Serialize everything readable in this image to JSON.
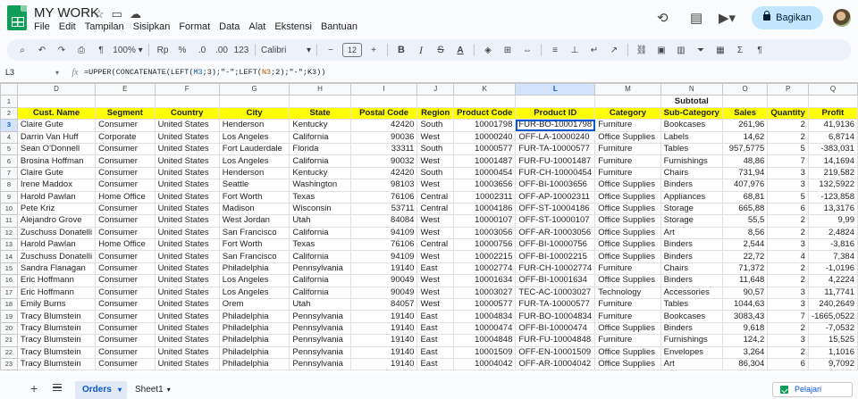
{
  "app": {
    "title": "MY WORK",
    "menu": [
      "File",
      "Edit",
      "Tampilan",
      "Sisipkan",
      "Format",
      "Data",
      "Alat",
      "Ekstensi",
      "Bantuan"
    ],
    "share_label": "Bagikan"
  },
  "toolbar": {
    "zoom": "100%",
    "currency": "Rp",
    "percent": "%",
    "dec_decrease": ".0",
    "dec_increase": ".00",
    "number_format": "123",
    "font": "Calibri",
    "font_size": "12"
  },
  "formula_bar": {
    "cell_ref": "L3",
    "formula_start": "=UPPER(CONCATENATE(LEFT(",
    "ref1": "M3",
    "formula_mid": ";3);\"-\";LEFT(",
    "ref2": "N3",
    "formula_end": ";2);\"-\";K3))"
  },
  "columns": [
    "D",
    "E",
    "F",
    "G",
    "H",
    "I",
    "J",
    "K",
    "L",
    "M",
    "N",
    "O",
    "P",
    "Q"
  ],
  "selected_column": "L",
  "row_numbers": [
    "1",
    "2",
    "3",
    "4",
    "5",
    "6",
    "7",
    "8",
    "9",
    "10",
    "11",
    "12",
    "13",
    "14",
    "15",
    "16",
    "17",
    "18",
    "19",
    "20",
    "21",
    "22",
    "23"
  ],
  "row1": {
    "subtotal": "Subtotal"
  },
  "headers": [
    "Cust. Name",
    "Segment",
    "Country",
    "City",
    "State",
    "Postal Code",
    "Region",
    "Product Code",
    "Product ID",
    "Category",
    "Sub-Category",
    "Sales",
    "Quantity",
    "Profit"
  ],
  "rows": [
    [
      "Claire Gute",
      "Consumer",
      "United States",
      "Henderson",
      "Kentucky",
      "42420",
      "South",
      "10001798",
      "FUR-BO-10001798",
      "Furniture",
      "Bookcases",
      "261,96",
      "2",
      "41,9136"
    ],
    [
      "Darrin Van Huff",
      "Corporate",
      "United States",
      "Los Angeles",
      "California",
      "90036",
      "West",
      "10000240",
      "OFF-LA-10000240",
      "Office Supplies",
      "Labels",
      "14,62",
      "2",
      "6,8714"
    ],
    [
      "Sean O'Donnell",
      "Consumer",
      "United States",
      "Fort Lauderdale",
      "Florida",
      "33311",
      "South",
      "10000577",
      "FUR-TA-10000577",
      "Furniture",
      "Tables",
      "957,5775",
      "5",
      "-383,031"
    ],
    [
      "Brosina Hoffman",
      "Consumer",
      "United States",
      "Los Angeles",
      "California",
      "90032",
      "West",
      "10001487",
      "FUR-FU-10001487",
      "Furniture",
      "Furnishings",
      "48,86",
      "7",
      "14,1694"
    ],
    [
      "Claire Gute",
      "Consumer",
      "United States",
      "Henderson",
      "Kentucky",
      "42420",
      "South",
      "10000454",
      "FUR-CH-10000454",
      "Furniture",
      "Chairs",
      "731,94",
      "3",
      "219,582"
    ],
    [
      "Irene Maddox",
      "Consumer",
      "United States",
      "Seattle",
      "Washington",
      "98103",
      "West",
      "10003656",
      "OFF-BI-10003656",
      "Office Supplies",
      "Binders",
      "407,976",
      "3",
      "132,5922"
    ],
    [
      "Harold Pawlan",
      "Home Office",
      "United States",
      "Fort Worth",
      "Texas",
      "76106",
      "Central",
      "10002311",
      "OFF-AP-10002311",
      "Office Supplies",
      "Appliances",
      "68,81",
      "5",
      "-123,858"
    ],
    [
      "Pete Kriz",
      "Consumer",
      "United States",
      "Madison",
      "Wisconsin",
      "53711",
      "Central",
      "10004186",
      "OFF-ST-10004186",
      "Office Supplies",
      "Storage",
      "665,88",
      "6",
      "13,3176"
    ],
    [
      "Alejandro Grove",
      "Consumer",
      "United States",
      "West Jordan",
      "Utah",
      "84084",
      "West",
      "10000107",
      "OFF-ST-10000107",
      "Office Supplies",
      "Storage",
      "55,5",
      "2",
      "9,99"
    ],
    [
      "Zuschuss Donatelli",
      "Consumer",
      "United States",
      "San Francisco",
      "California",
      "94109",
      "West",
      "10003056",
      "OFF-AR-10003056",
      "Office Supplies",
      "Art",
      "8,56",
      "2",
      "2,4824"
    ],
    [
      "Harold Pawlan",
      "Home Office",
      "United States",
      "Fort Worth",
      "Texas",
      "76106",
      "Central",
      "10000756",
      "OFF-BI-10000756",
      "Office Supplies",
      "Binders",
      "2,544",
      "3",
      "-3,816"
    ],
    [
      "Zuschuss Donatelli",
      "Consumer",
      "United States",
      "San Francisco",
      "California",
      "94109",
      "West",
      "10002215",
      "OFF-BI-10002215",
      "Office Supplies",
      "Binders",
      "22,72",
      "4",
      "7,384"
    ],
    [
      "Sandra Flanagan",
      "Consumer",
      "United States",
      "Philadelphia",
      "Pennsylvania",
      "19140",
      "East",
      "10002774",
      "FUR-CH-10002774",
      "Furniture",
      "Chairs",
      "71,372",
      "2",
      "-1,0196"
    ],
    [
      "Eric Hoffmann",
      "Consumer",
      "United States",
      "Los Angeles",
      "California",
      "90049",
      "West",
      "10001634",
      "OFF-BI-10001634",
      "Office Supplies",
      "Binders",
      "11,648",
      "2",
      "4,2224"
    ],
    [
      "Eric Hoffmann",
      "Consumer",
      "United States",
      "Los Angeles",
      "California",
      "90049",
      "West",
      "10003027",
      "TEC-AC-10003027",
      "Technology",
      "Accessories",
      "90,57",
      "3",
      "11,7741"
    ],
    [
      "Emily Burns",
      "Consumer",
      "United States",
      "Orem",
      "Utah",
      "84057",
      "West",
      "10000577",
      "FUR-TA-10000577",
      "Furniture",
      "Tables",
      "1044,63",
      "3",
      "240,2649"
    ],
    [
      "Tracy Blumstein",
      "Consumer",
      "United States",
      "Philadelphia",
      "Pennsylvania",
      "19140",
      "East",
      "10004834",
      "FUR-BO-10004834",
      "Furniture",
      "Bookcases",
      "3083,43",
      "7",
      "-1665,0522"
    ],
    [
      "Tracy Blumstein",
      "Consumer",
      "United States",
      "Philadelphia",
      "Pennsylvania",
      "19140",
      "East",
      "10000474",
      "OFF-BI-10000474",
      "Office Supplies",
      "Binders",
      "9,618",
      "2",
      "-7,0532"
    ],
    [
      "Tracy Blumstein",
      "Consumer",
      "United States",
      "Philadelphia",
      "Pennsylvania",
      "19140",
      "East",
      "10004848",
      "FUR-FU-10004848",
      "Furniture",
      "Furnishings",
      "124,2",
      "3",
      "15,525"
    ],
    [
      "Tracy Blumstein",
      "Consumer",
      "United States",
      "Philadelphia",
      "Pennsylvania",
      "19140",
      "East",
      "10001509",
      "OFF-EN-10001509",
      "Office Supplies",
      "Envelopes",
      "3,264",
      "2",
      "1,1016"
    ],
    [
      "Tracy Blumstein",
      "Consumer",
      "United States",
      "Philadelphia",
      "Pennsylvania",
      "19140",
      "East",
      "10004042",
      "OFF-AR-10004042",
      "Office Supplies",
      "Art",
      "86,304",
      "6",
      "9,7092"
    ]
  ],
  "sheets": {
    "active": "Orders",
    "other": "Sheet1"
  },
  "explore_label": "Pelajari"
}
